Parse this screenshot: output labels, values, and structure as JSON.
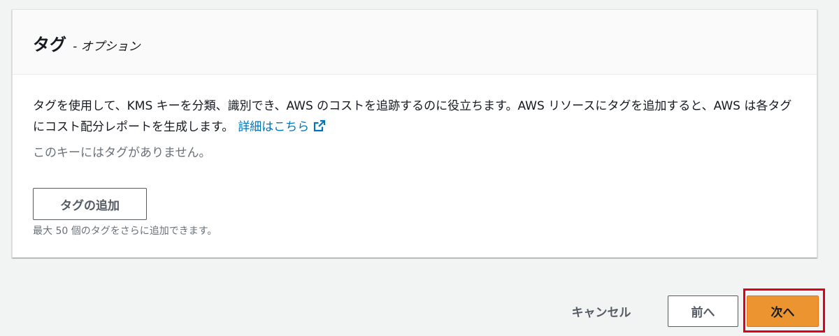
{
  "panel": {
    "title": "タグ",
    "subtitle": "- オプション",
    "description": "タグを使用して、KMS キーを分類、識別でき、AWS のコストを追跡するのに役立ちます。AWS リソースにタグを追加すると、AWS は各タグにコスト配分レポートを生成します。",
    "learn_more": "詳細はこちら",
    "learn_more_icon": "external-link-icon",
    "empty_state": "このキーにはタグがありません。",
    "add_tag_label": "タグの追加",
    "limit_hint": "最大 50 個のタグをさらに追加できます。"
  },
  "footer": {
    "cancel_label": "キャンセル",
    "prev_label": "前へ",
    "next_label": "次へ"
  },
  "colors": {
    "page_background": "#f2f3f3",
    "link": "#0073bb",
    "primary_button": "#ec9430",
    "highlight_border": "#e0001b",
    "muted_text": "#687078"
  }
}
